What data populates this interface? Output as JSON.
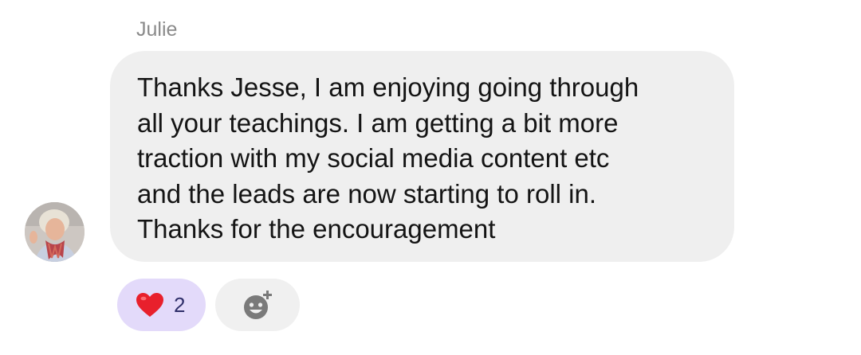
{
  "message": {
    "sender": "Julie",
    "text_lines": [
      "Thanks Jesse, I am enjoying going through",
      "all your teachings. I am getting a bit more",
      "traction with my social media content etc",
      "and the leads are now starting to roll in.",
      "Thanks for the encouragement"
    ]
  },
  "reactions": {
    "heart": {
      "icon": "heart-icon",
      "count": "2",
      "color": "#e8202c"
    },
    "add": {
      "icon": "add-reaction-icon"
    }
  },
  "colors": {
    "bubble": "#efefef",
    "reaction_selected": "#e3dafa",
    "reaction_idle": "#f0f0f0"
  }
}
